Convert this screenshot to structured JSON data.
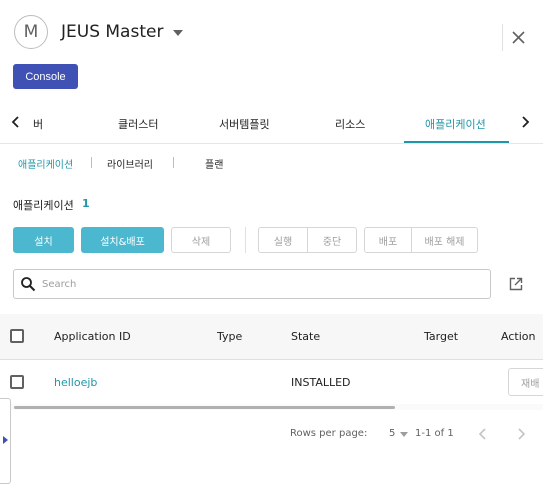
{
  "header": {
    "avatar_letter": "M",
    "server_name": "JEUS Master",
    "console_label": "Console"
  },
  "main_tabs": [
    {
      "label": "버"
    },
    {
      "label": "클러스터"
    },
    {
      "label": "서버템플릿"
    },
    {
      "label": "리소스"
    },
    {
      "label": "애플리케이션",
      "active": true
    }
  ],
  "sub_tabs": [
    {
      "label": "애플리케이션",
      "active": true
    },
    {
      "label": "라이브러리"
    },
    {
      "label": "플랜"
    }
  ],
  "section": {
    "title": "애플리케이션",
    "count": "1"
  },
  "actions": {
    "install": "설치",
    "install_deploy": "설치&배포",
    "delete": "삭제",
    "run": "실행",
    "stop": "중단",
    "deploy": "배포",
    "undeploy": "배포 해제"
  },
  "search": {
    "placeholder": "Search",
    "value": ""
  },
  "table": {
    "columns": [
      "Application ID",
      "Type",
      "State",
      "Target",
      "Action"
    ],
    "rows": [
      {
        "id": "helloejb",
        "type": "",
        "state": "INSTALLED",
        "target": "",
        "action": "재배"
      }
    ]
  },
  "pagination": {
    "rows_per_page_label": "Rows per page:",
    "rows_per_page": "5",
    "range": "1-1 of 1"
  },
  "colors": {
    "accent": "#2196a8",
    "primary_button": "#4cb8cf",
    "console_button": "#3f51b5"
  },
  "icons": [
    "close-icon",
    "chevron-left-icon",
    "chevron-right-icon",
    "search-icon",
    "open-in-new-icon",
    "caret-down-icon"
  ]
}
